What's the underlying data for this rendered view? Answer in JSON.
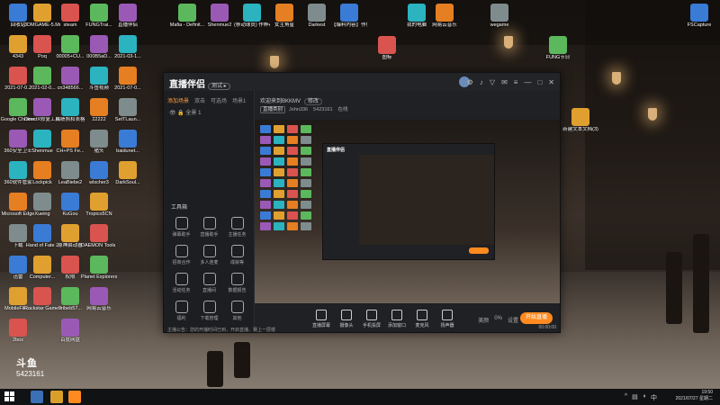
{
  "desktop_icons_col1": [
    "回收站",
    "4343",
    "2021-07-0...",
    "Google Chrome",
    "360安全卫士",
    "360软件管家",
    "Microsoft Edge",
    "下载",
    "迅雷",
    "MobileFile...",
    "2box"
  ],
  "desktop_icons_col2": [
    "3DMGAME-5.Mr.AntiEu...",
    "Poq",
    "2021-02-0...",
    "DirectX修复工具",
    "Shenmue",
    "Lockpick",
    "Xueing",
    "Hand of Fate 2",
    "Computer...",
    "Rockstar Games..."
  ],
  "desktop_icons_col3": [
    "steam",
    "00005+CU...",
    "cn348566...",
    "成绩照和表格",
    "CH+PS Fe...",
    "LeaBiebe2",
    "KuGou",
    "原神启动器",
    "权限",
    "9ribeb57...",
    "百度网盘"
  ],
  "desktop_icons_col4": [
    "FUNGTrai...",
    "000B5aD...",
    "斗鱼视频",
    "22222",
    "猪头",
    "wlscher3",
    "Tropico5CN",
    "DAEMON Tools Lite",
    "Planet Explorers",
    "网易云音乐"
  ],
  "desktop_icons_col5": [
    "直播伴侣",
    "2021-03-1...",
    "2021-07-0...",
    "SetTLaun...",
    "baidunet...",
    "DarkSoul..."
  ],
  "desktop_icons_top": [
    "Mafia - Definit...",
    "Shenmue2",
    "(移动球员) 作弊者",
    "女主角星",
    "Darkest",
    "【爆料内容】作弊器..."
  ],
  "desktop_icons_right": [
    "我的电脑",
    "网易云音乐",
    "wegame",
    "FSCapture",
    "新建文本文档(3)",
    "图标",
    "FUNG节日"
  ],
  "window": {
    "brand": "直播伴侣",
    "brand_tag": "测试 ▸",
    "tabs": [
      "添加场景",
      "双击",
      "可选场",
      "场景1"
    ],
    "scene_label": "全景 1",
    "tools_title": "工具箱",
    "tools": [
      "弹幕助手",
      "直播助手",
      "主播任务",
      "招商合作",
      "多人连麦",
      "成就等",
      "活动任务",
      "直播间",
      "数据报告",
      "福利",
      "下载管理",
      "其他"
    ],
    "notice": "主播公告：您的开播时间已到，开启直播，赛上一层楼",
    "welcome": "欢迎来到BKKMV",
    "welcome_btn": "修改",
    "sub_chip": "直播类别",
    "sub_items": [
      "John336",
      "5423161",
      "在线"
    ],
    "toolbar": [
      "直播屏幕",
      "摄像头",
      "手机投屏",
      "添加窗口",
      "麦克风",
      "扬声器"
    ],
    "toolbar_right": [
      "美颜",
      "0%",
      "设置"
    ],
    "start_live": "开始直播",
    "timer": "00:00:00"
  },
  "overlay": {
    "big": "斗鱼",
    "num": "5423161"
  },
  "taskbar": {
    "time": "19:50",
    "date": "2021/07/27 星期二"
  }
}
